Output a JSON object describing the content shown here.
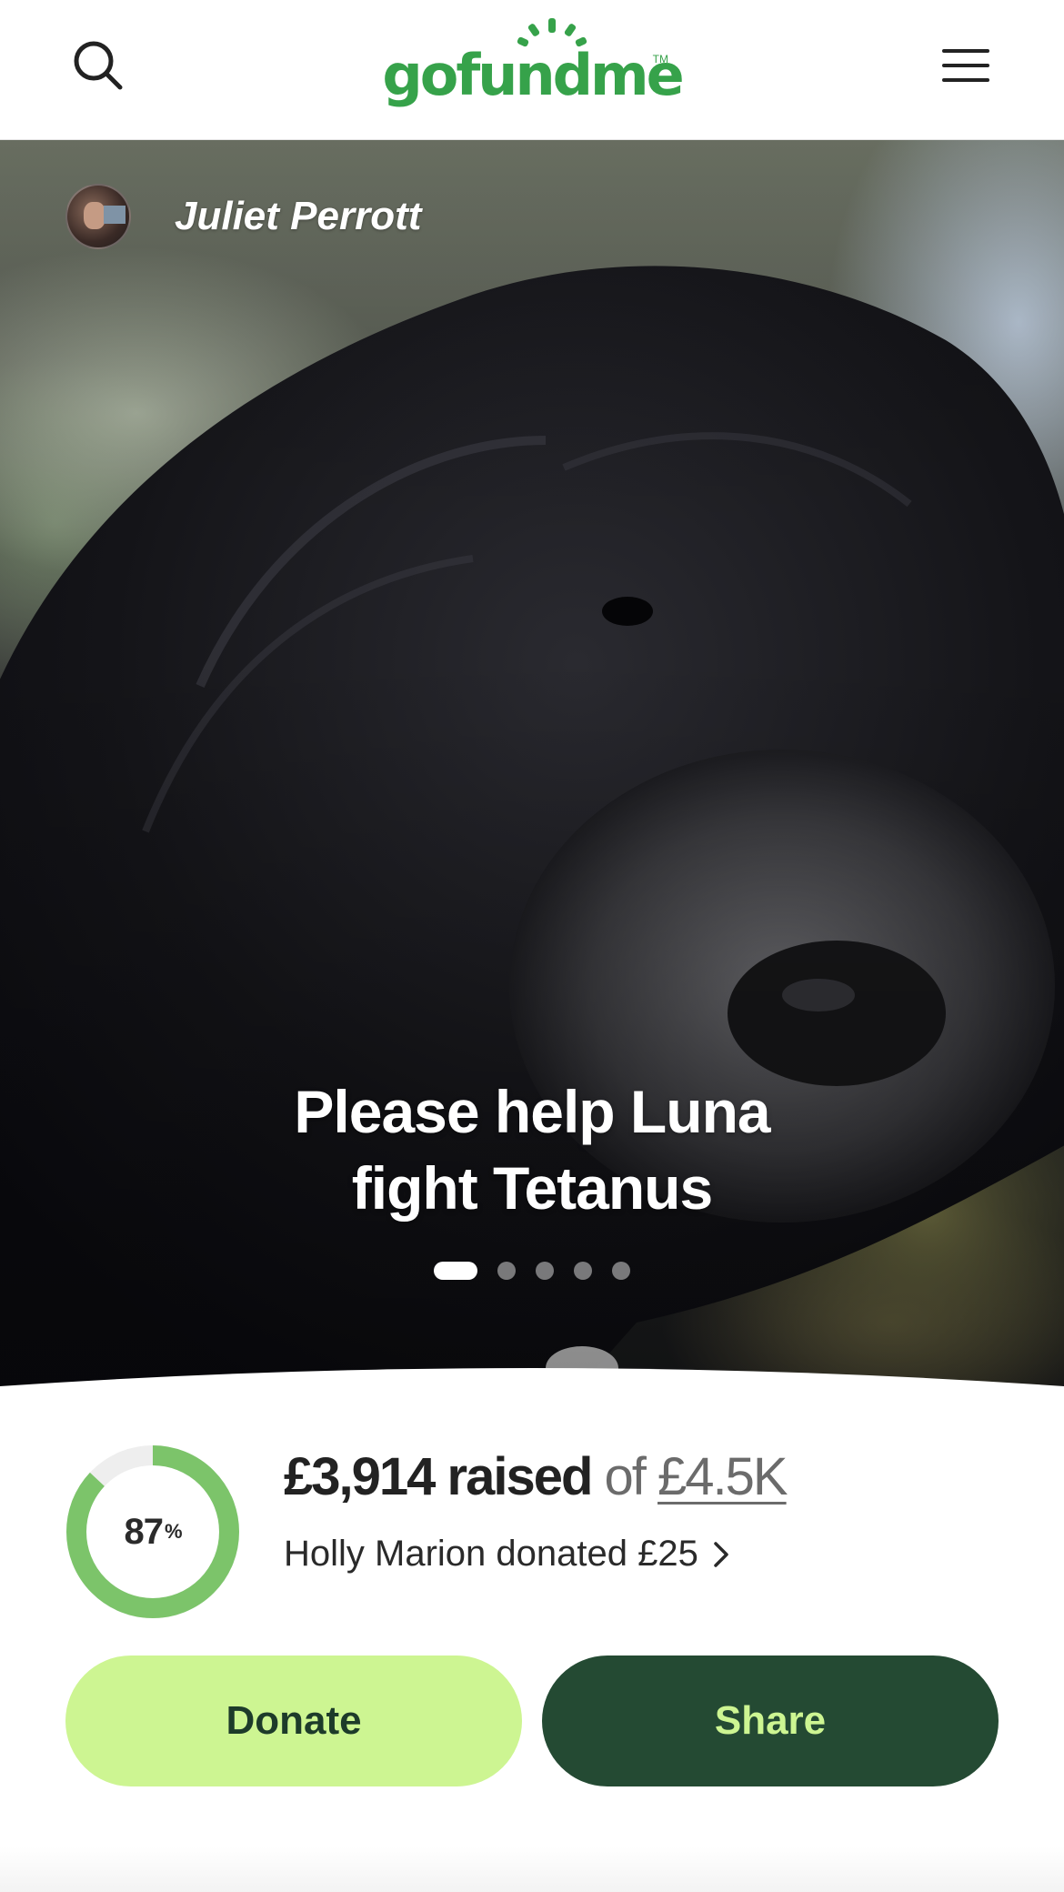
{
  "header": {
    "logo_text": "gofundme",
    "logo_tm": "TM",
    "search_icon": "search-icon",
    "menu_icon": "hamburger-menu-icon",
    "brand_color": "#36a24a"
  },
  "hero": {
    "organizer_name": "Juliet Perrott",
    "title_line1": "Please help Luna",
    "title_line2": "fight Tetanus",
    "carousel": {
      "total": 5,
      "active_index": 0
    }
  },
  "fundraiser": {
    "progress_percent": "87",
    "progress_symbol": "%",
    "progress_fraction": 0.87,
    "raised_amount": "£3,914 raised",
    "of_text": "of",
    "goal": "£4.5K",
    "recent_donation": "Holly Marion donated £25",
    "progress_color": "#7cc46a",
    "progress_track_color": "#eeeeee"
  },
  "actions": {
    "donate_label": "Donate",
    "share_label": "Share",
    "donate_color": "#cdf592",
    "share_color": "#244a33"
  }
}
